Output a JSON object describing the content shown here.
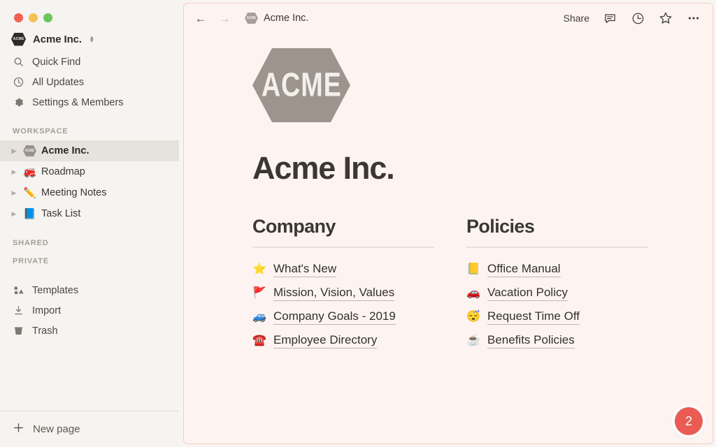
{
  "window": {
    "traffic_lights": [
      "close",
      "minimize",
      "maximize"
    ]
  },
  "sidebar": {
    "workspace_switcher": {
      "logo_text": "ACME",
      "name": "Acme Inc.",
      "chevron_icon": "chevron-up-down-icon"
    },
    "quick_items": [
      {
        "label": "Quick Find",
        "icon": "search-icon"
      },
      {
        "label": "All Updates",
        "icon": "clock-icon"
      },
      {
        "label": "Settings & Members",
        "icon": "gear-icon"
      }
    ],
    "sections": [
      {
        "title": "WORKSPACE",
        "pages": [
          {
            "label": "Acme Inc.",
            "emoji": "ACME",
            "icon": "acme-logo-icon",
            "active": true
          },
          {
            "label": "Roadmap",
            "emoji": "🚒",
            "icon": "fire-engine-icon",
            "active": false
          },
          {
            "label": "Meeting Notes",
            "emoji": "✏️",
            "icon": "pencil-icon",
            "active": false
          },
          {
            "label": "Task List",
            "emoji": "📘",
            "icon": "blue-book-icon",
            "active": false
          }
        ]
      },
      {
        "title": "SHARED",
        "pages": []
      },
      {
        "title": "PRIVATE",
        "pages": []
      }
    ],
    "utility_items": [
      {
        "label": "Templates",
        "icon": "templates-icon"
      },
      {
        "label": "Import",
        "icon": "import-download-icon"
      },
      {
        "label": "Trash",
        "icon": "trash-icon"
      }
    ],
    "footer": {
      "new_page_label": "New page",
      "new_page_icon": "plus-icon"
    }
  },
  "topbar": {
    "back_icon": "arrow-left-icon",
    "forward_icon": "arrow-right-icon",
    "breadcrumb": {
      "logo_text": "ACME",
      "label": "Acme Inc."
    },
    "share_label": "Share",
    "icons": [
      {
        "name": "comment-icon"
      },
      {
        "name": "clock-history-icon"
      },
      {
        "name": "star-favorite-icon"
      },
      {
        "name": "more-options-icon"
      }
    ]
  },
  "page": {
    "cover_logo_text": "ACME",
    "title": "Acme Inc.",
    "columns": [
      {
        "heading": "Company",
        "links": [
          {
            "emoji": "⭐",
            "icon": "star-emoji-icon",
            "label": "What's New"
          },
          {
            "emoji": "🚩",
            "icon": "triangular-flag-icon",
            "label": "Mission, Vision, Values"
          },
          {
            "emoji": "🚙",
            "icon": "blue-car-icon",
            "label": "Company Goals - 2019"
          },
          {
            "emoji": "☎️",
            "icon": "telephone-icon",
            "label": "Employee Directory"
          }
        ]
      },
      {
        "heading": "Policies",
        "links": [
          {
            "emoji": "📒",
            "icon": "ledger-notebook-icon",
            "label": "Office Manual"
          },
          {
            "emoji": "🚗",
            "icon": "red-car-icon",
            "label": "Vacation Policy"
          },
          {
            "emoji": "😴",
            "icon": "sleeping-face-icon",
            "label": "Request Time Off"
          },
          {
            "emoji": "☕",
            "icon": "coffee-icon",
            "label": "Benefits Policies"
          }
        ]
      }
    ],
    "notification_badge": {
      "count": "2"
    }
  },
  "colors": {
    "sidebar_bg": "#f6f4f1",
    "main_bg": "#fdf4f1",
    "main_border": "#f6cdc7",
    "logo_gray": "#9c948d",
    "badge_red": "#ea5b53",
    "text_dark": "#3b3733"
  }
}
